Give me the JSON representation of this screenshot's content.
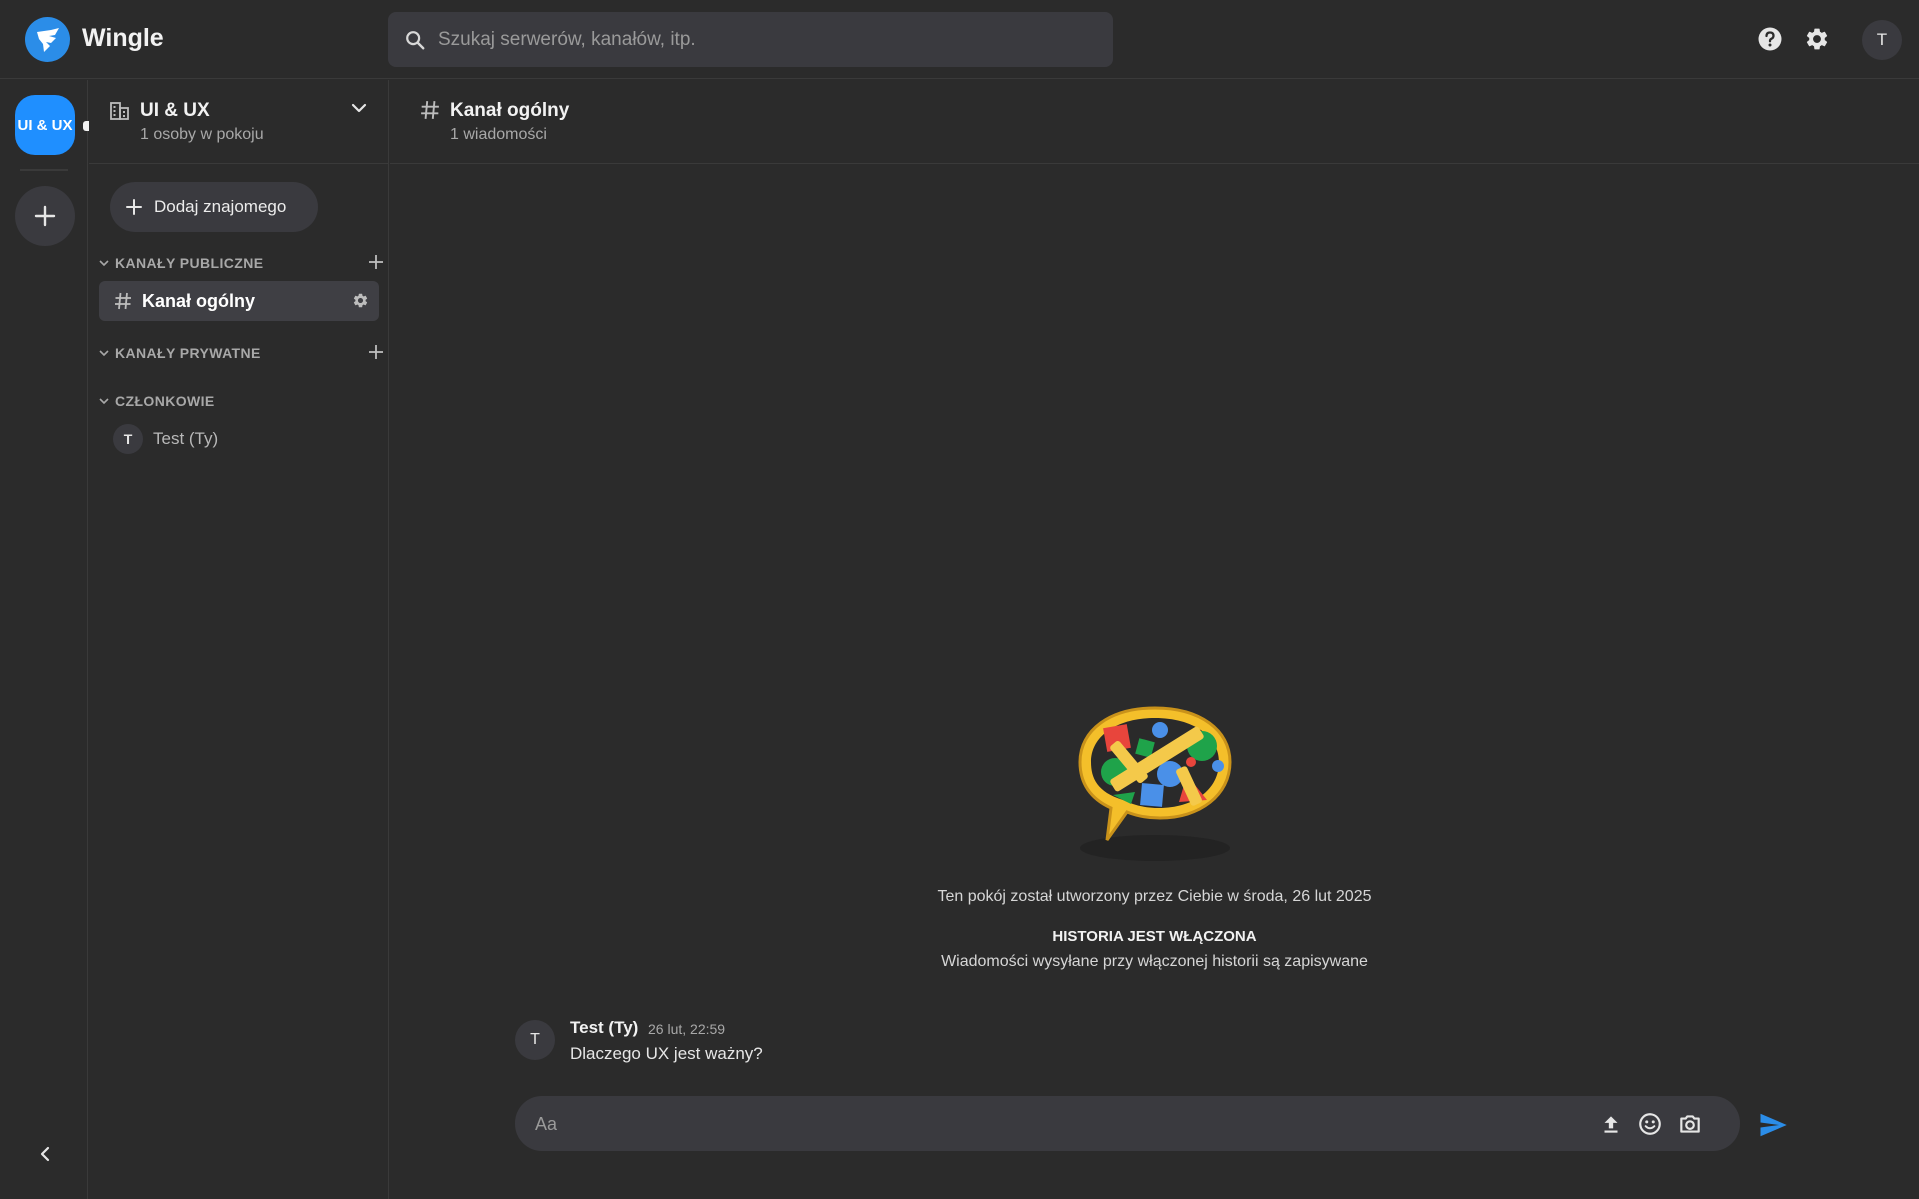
{
  "app": {
    "name": "Wingle",
    "brand_color": "#2b8de8",
    "accent_color": "#1f8fff"
  },
  "search": {
    "placeholder": "Szukaj serwerów, kanałów, itp."
  },
  "topbar": {
    "help_icon": "help-circle-icon",
    "settings_icon": "gear-icon",
    "avatar_letter": "T"
  },
  "rail": {
    "server_label": "UI & UX",
    "add_server_icon": "plus-icon",
    "collapse_icon": "chevron-left-icon"
  },
  "sidebar": {
    "room_name": "UI & UX",
    "room_subtitle": "1 osoby w pokoju",
    "add_friend_label": "Dodaj znajomego",
    "sections": {
      "public_channels": "KANAŁY PUBLICZNE",
      "private_channels": "KANAŁY PRYWATNE",
      "members": "CZŁONKOWIE"
    },
    "channels": [
      {
        "name": "Kanał ogólny",
        "active": true
      }
    ],
    "members_list": [
      {
        "initial": "T",
        "name": "Test (Ty)"
      }
    ]
  },
  "channel": {
    "title": "Kanał ogólny",
    "subtitle": "1 wiadomości",
    "created_text": "Ten pokój został utworzony przez Ciebie w środa, 26 lut 2025",
    "history_title": "HISTORIA JEST WŁĄCZONA",
    "history_subtitle": "Wiadomości wysyłane przy włączonej historii są zapisywane"
  },
  "messages": [
    {
      "avatar": "T",
      "author": "Test (Ty)",
      "time": "26 lut, 22:59",
      "text": "Dlaczego UX jest ważny?"
    }
  ],
  "composer": {
    "placeholder": "Aa",
    "icons": [
      "upload-icon",
      "emoji-icon",
      "camera-icon",
      "send-icon"
    ]
  }
}
